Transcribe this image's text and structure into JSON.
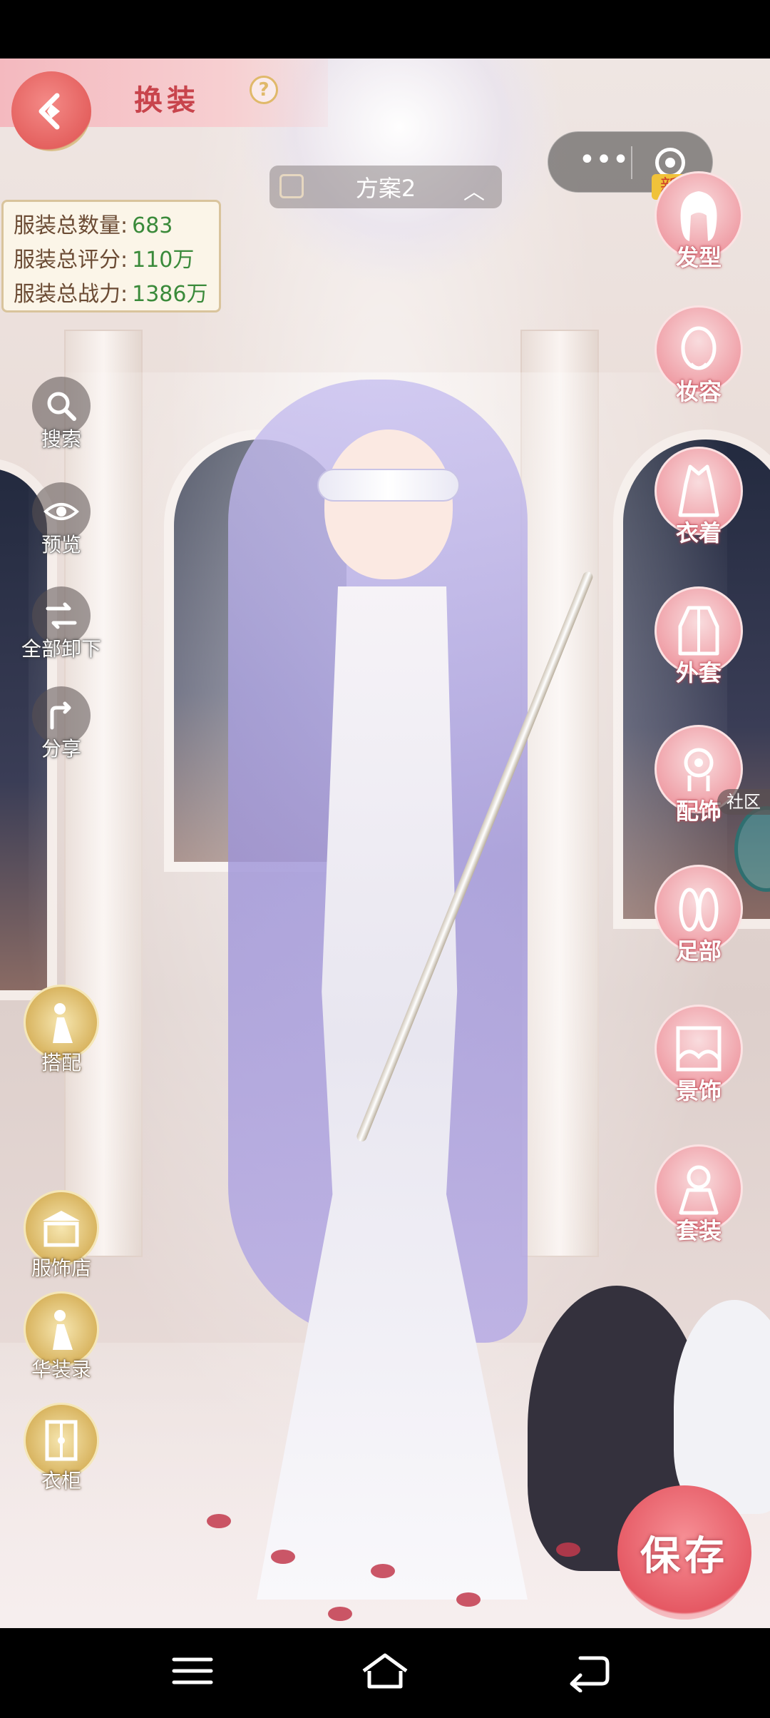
{
  "header": {
    "title": "换装",
    "help": "?"
  },
  "scheme": {
    "label": "方案2"
  },
  "stats": {
    "total_count_label": "服装总数量:",
    "total_count_value": "683",
    "total_score_label": "服装总评分:",
    "total_score_value": "110万",
    "total_power_label": "服装总战力:",
    "total_power_value": "1386万"
  },
  "left_tools": [
    {
      "label": "搜索",
      "icon": "search-icon"
    },
    {
      "label": "预览",
      "icon": "eye-icon"
    },
    {
      "label": "全部卸下",
      "icon": "unequip-icon"
    },
    {
      "label": "分享",
      "icon": "share-icon"
    }
  ],
  "gold_tools": [
    {
      "label": "搭配",
      "icon": "outfit-match-icon"
    },
    {
      "label": "服饰店",
      "icon": "shop-icon"
    },
    {
      "label": "华装录",
      "icon": "collection-icon"
    },
    {
      "label": "衣柜",
      "icon": "wardrobe-icon"
    }
  ],
  "categories": [
    {
      "label": "发型",
      "icon": "hairstyle-icon"
    },
    {
      "label": "妆容",
      "icon": "makeup-icon"
    },
    {
      "label": "衣着",
      "icon": "clothing-icon"
    },
    {
      "label": "外套",
      "icon": "coat-icon"
    },
    {
      "label": "配饰",
      "icon": "accessory-icon"
    },
    {
      "label": "足部",
      "icon": "shoes-icon"
    },
    {
      "label": "景饰",
      "icon": "scene-icon"
    },
    {
      "label": "套装",
      "icon": "suit-icon"
    }
  ],
  "badges": {
    "new": "新",
    "community": "社区"
  },
  "save_label": "保存",
  "colors": {
    "accent_pink": "#e55863",
    "gold": "#d9b561",
    "stat_green": "#3a8a3a"
  }
}
